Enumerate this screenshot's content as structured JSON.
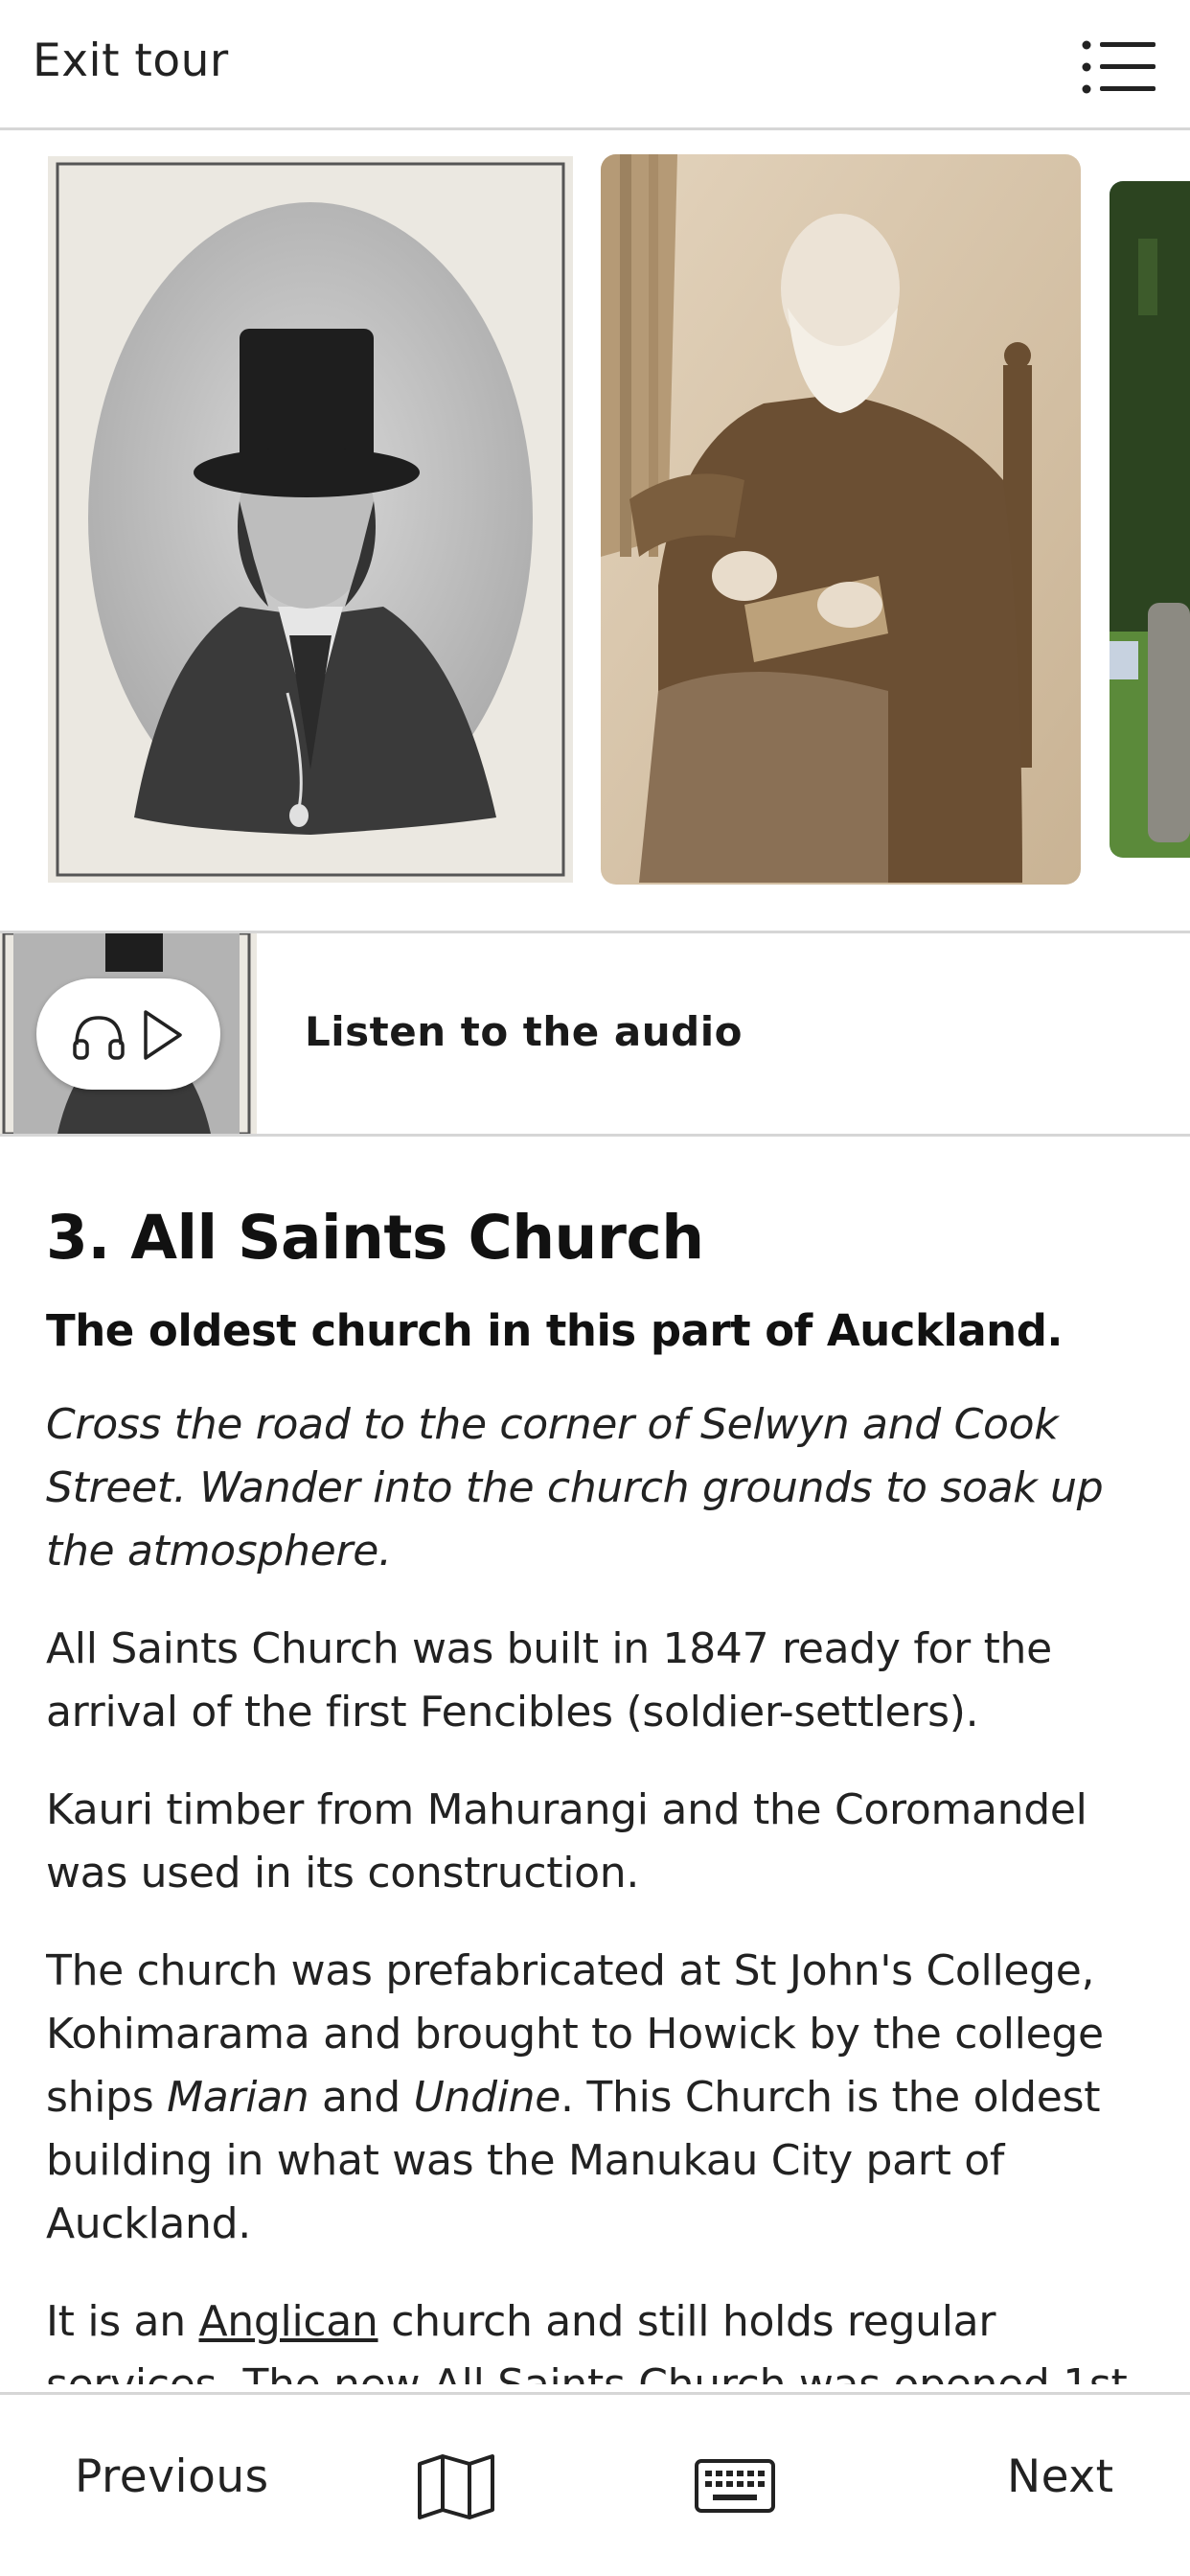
{
  "header": {
    "exit_label": "Exit tour",
    "menu_icon": "list-menu-icon"
  },
  "gallery": {
    "images": [
      {
        "name": "oval-portrait-man-top-hat",
        "tone": "#4a4a4a"
      },
      {
        "name": "sepia-portrait-seated-clergyman",
        "tone": "#a8875f"
      },
      {
        "name": "church-grounds-tree-photo",
        "tone": "#3b5a2a"
      }
    ]
  },
  "audio": {
    "label": "Listen to the audio",
    "icons": [
      "headphones-icon",
      "play-icon"
    ]
  },
  "stop": {
    "title": "3. All Saints Church",
    "subtitle": "The oldest church in this part of Auckland.",
    "directions": "Cross the road to the corner of Selwyn and Cook Street. Wander into the church grounds to soak up the atmosphere.",
    "para1": "All Saints Church was built in 1847 ready for the arrival of the first Fencibles (soldier-settlers).",
    "para2": "Kauri timber from Mahurangi and the Coromandel was used in its construction.",
    "para3": {
      "part1": "The church was prefabricated at St John's College, Kohimarama and brought to Howick by the college ships ",
      "ship1": "Marian",
      "and": " and ",
      "ship2": "Undine",
      "part2": ". This Church is the oldest building in what was the Manukau City part of Auckland."
    },
    "para4": {
      "prefix": "It is an ",
      "link": "Anglican",
      "suffix": " church and still holds regular services. The new All Saints Church was opened 1st"
    }
  },
  "footer": {
    "previous_label": "Previous",
    "next_label": "Next",
    "map_icon": "map-icon",
    "keyboard_icon": "keyboard-icon"
  },
  "colors": {
    "divider": "#d6d6d6",
    "text": "#1a1a1a",
    "sepia": "#a8875f"
  }
}
